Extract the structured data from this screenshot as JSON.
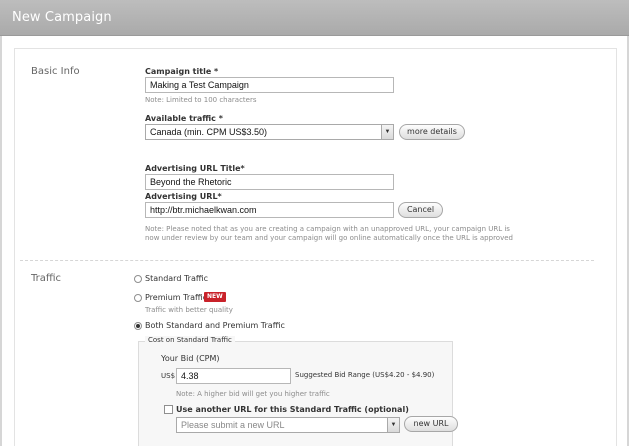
{
  "header": {
    "title": "New Campaign"
  },
  "basic_info": {
    "section_label": "Basic Info",
    "campaign_title": {
      "label": "Campaign title *",
      "value": "Making a Test Campaign",
      "note": "Note: Limited to 100 characters"
    },
    "available_traffic": {
      "label": "Available traffic *",
      "selected": "Canada (min. CPM US$3.50)",
      "more_details_label": "more details"
    },
    "advertising_url_title": {
      "label": "Advertising URL Title*",
      "value": "Beyond the Rhetoric"
    },
    "advertising_url": {
      "label": "Advertising URL*",
      "value": "http://btr.michaelkwan.com",
      "cancel_label": "Cancel",
      "note_line1": "Note: Please noted that as you are creating a campaign with an unapproved URL, your campaign URL is",
      "note_line2": "now under review by our team and your campaign will go online automatically once the URL is approved"
    }
  },
  "traffic": {
    "section_label": "Traffic",
    "options": [
      {
        "label": "Standard Traffic",
        "checked": false
      },
      {
        "label": "Premium Traffic",
        "badge": "NEW",
        "sublabel": "Traffic with better quality",
        "checked": false
      },
      {
        "label": "Both Standard and Premium Traffic",
        "checked": true
      }
    ],
    "standard_cost": {
      "legend": "Cost on Standard Traffic",
      "bid_label": "Your Bid (CPM)",
      "currency": "US$",
      "bid_value": "4.38",
      "suggested_range": "Suggested Bid Range (US$4.20 - $4.90)",
      "bid_note": "Note: A higher bid will get you higher traffic",
      "alt_url_checkbox_label": "Use another URL for this Standard Traffic (optional)",
      "alt_url_placeholder": "Please submit a new URL",
      "new_url_label": "new URL"
    }
  }
}
